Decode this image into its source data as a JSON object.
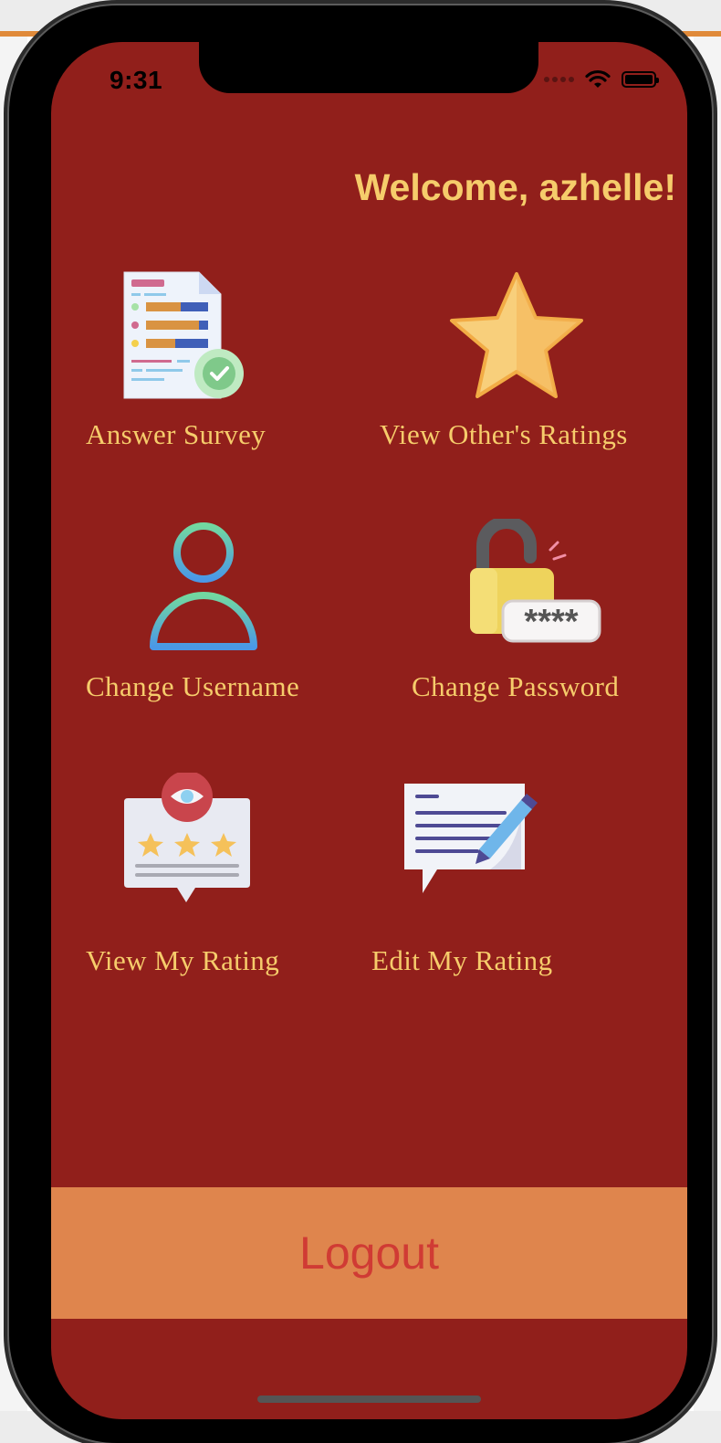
{
  "status_bar": {
    "time": "9:31"
  },
  "header": {
    "welcome_text": "Welcome, azhelle!"
  },
  "menu": {
    "answer_survey": {
      "label": "Answer Survey",
      "icon": "survey-document-icon"
    },
    "view_others_ratings": {
      "label": "View Other's Ratings",
      "icon": "star-icon"
    },
    "change_username": {
      "label": "Change Username",
      "icon": "user-icon"
    },
    "change_password": {
      "label": "Change Password",
      "icon": "padlock-password-icon",
      "password_mask": "****"
    },
    "view_my_rating": {
      "label": "View My Rating",
      "icon": "rating-review-icon"
    },
    "edit_my_rating": {
      "label": "Edit My Rating",
      "icon": "edit-message-icon"
    }
  },
  "logout": {
    "label": "Logout"
  },
  "colors": {
    "screen_background": "#911f1b",
    "accent_text": "#f6cc6b",
    "logout_background": "#df854d",
    "logout_text": "#d03b34"
  }
}
